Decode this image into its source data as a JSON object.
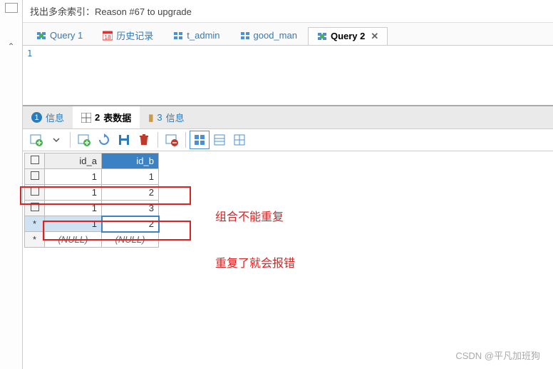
{
  "titleStrip": "找出多余索引：Reason #67 to upgrade",
  "tabs": [
    {
      "label": "Query 1"
    },
    {
      "label": "历史记录"
    },
    {
      "label": "t_admin"
    },
    {
      "label": "good_man"
    },
    {
      "label": "Query 2"
    }
  ],
  "editor": {
    "lineNumber": "1"
  },
  "subtabs": [
    {
      "num": "1",
      "label": "信息"
    },
    {
      "num": "2",
      "label": "表数据"
    },
    {
      "num": "3",
      "label": "信息"
    }
  ],
  "grid": {
    "headers": [
      "id_a",
      "id_b"
    ],
    "rows": [
      {
        "marker": "check",
        "a": "1",
        "b": "1"
      },
      {
        "marker": "check",
        "a": "1",
        "b": "2"
      },
      {
        "marker": "check",
        "a": "1",
        "b": "3"
      },
      {
        "marker": "star",
        "a": "1",
        "b": "2",
        "editing": true
      },
      {
        "marker": "star",
        "a": "(NULL)",
        "b": "(NULL)",
        "null": true
      }
    ]
  },
  "annotations": {
    "a1": "组合不能重复",
    "a2": "重复了就会报错"
  },
  "watermark": "CSDN @平凡加班狗"
}
